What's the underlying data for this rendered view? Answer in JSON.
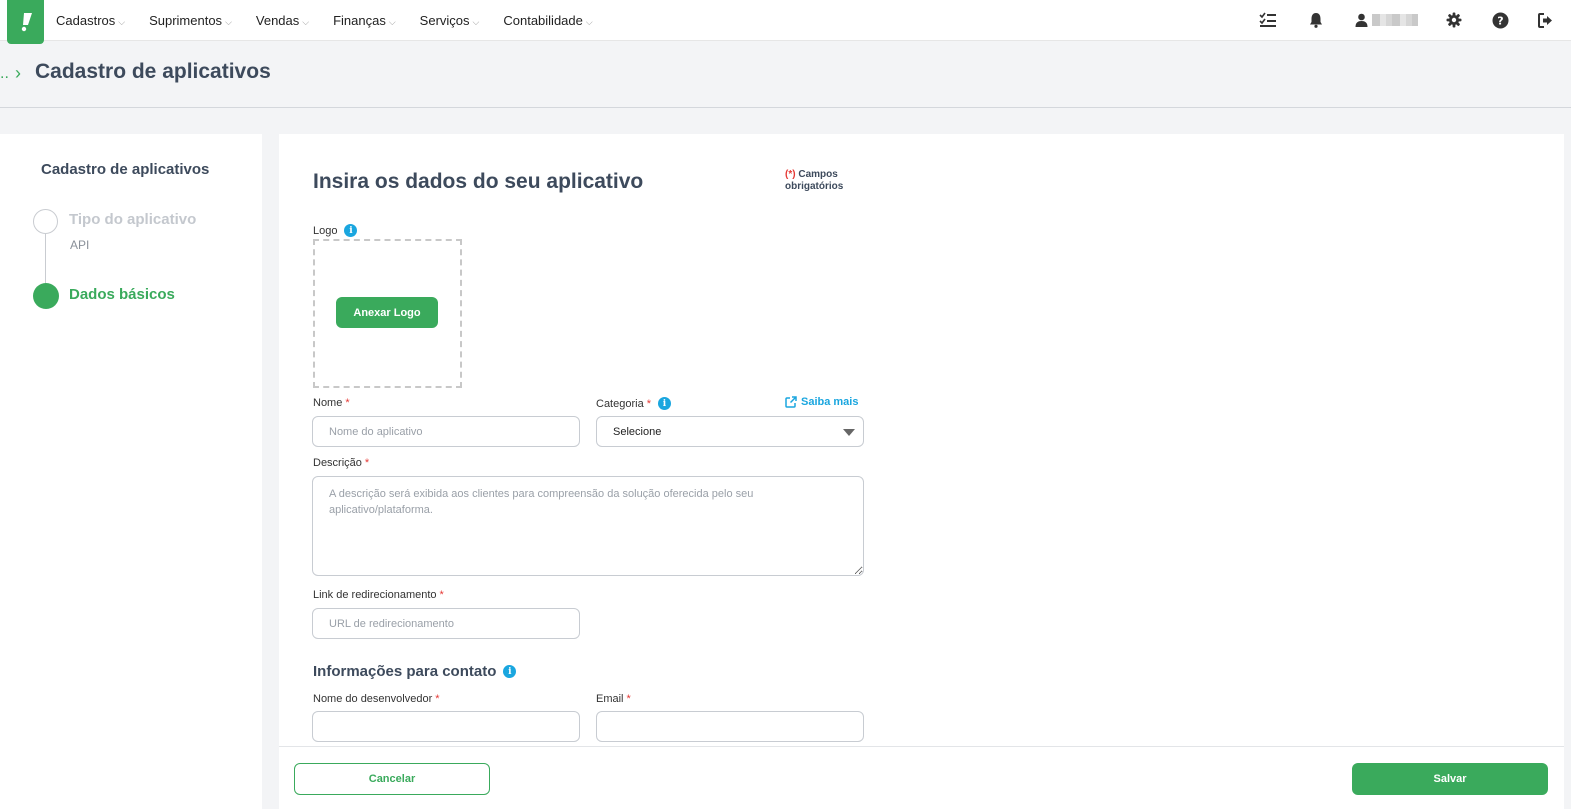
{
  "nav": {
    "items": [
      {
        "label": "Cadastros"
      },
      {
        "label": "Suprimentos"
      },
      {
        "label": "Vendas"
      },
      {
        "label": "Finanças"
      },
      {
        "label": "Serviços"
      },
      {
        "label": "Contabilidade"
      }
    ],
    "icons": [
      "tasks-icon",
      "bell-icon",
      "user-icon",
      "gear-icon",
      "help-icon",
      "logout-icon"
    ]
  },
  "breadcrumb": {
    "ellipsis": "..",
    "separator": "›"
  },
  "page": {
    "title": "Cadastro de aplicativos"
  },
  "stepper": {
    "title": "Cadastro de aplicativos",
    "steps": [
      {
        "label": "Tipo do aplicativo",
        "sub": "API"
      },
      {
        "label": "Dados básicos"
      }
    ]
  },
  "form": {
    "title": "Insira os dados do seu aplicativo",
    "required_note_star": "(*)",
    "required_note_line1": "Campos",
    "required_note_line2": "obrigatórios",
    "logo_label": "Logo",
    "attach_logo": "Anexar Logo",
    "name_label": "Nome",
    "name_placeholder": "Nome do aplicativo",
    "category_label": "Categoria",
    "category_value": "Selecione",
    "learn_more": "Saiba mais",
    "description_label": "Descrição",
    "description_placeholder": "A descrição será exibida aos clientes para compreensão da solução oferecida pelo seu aplicativo/plataforma.",
    "redirect_label": "Link de redirecionamento",
    "redirect_placeholder": "URL de redirecionamento",
    "contact_title": "Informações para contato",
    "developer_label": "Nome do desenvolvedor",
    "email_label": "Email",
    "required_mark": "*"
  },
  "footer": {
    "cancel": "Cancelar",
    "save": "Salvar"
  },
  "colors": {
    "brand": "#3aaa5c",
    "info": "#1aa6df",
    "required": "#e53935",
    "heading": "#3d4a5c"
  }
}
